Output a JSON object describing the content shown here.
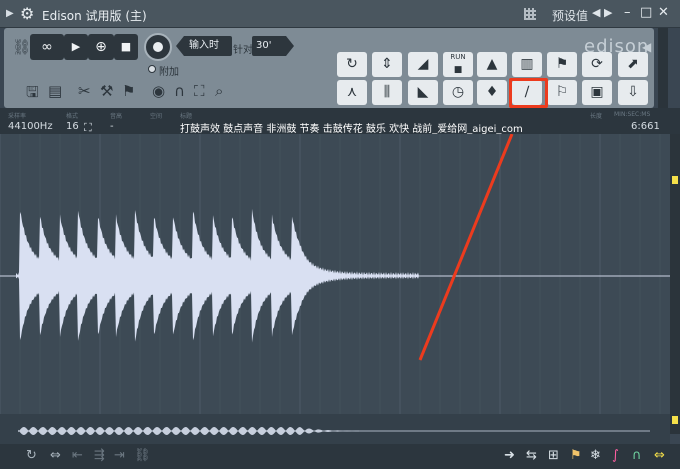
{
  "window": {
    "title": "Edison 试用版 (主)",
    "preset_label": "预设值"
  },
  "toolbar": {
    "input_label": "输入时",
    "for_label": "针对",
    "duration_value": "30'",
    "attach_label": "附加",
    "brand": "edison"
  },
  "tools_row1": [
    {
      "name": "refresh-icon",
      "glyph": "↻"
    },
    {
      "name": "center-split-icon",
      "glyph": "⇕"
    },
    {
      "name": "ramp-icon",
      "glyph": "◢"
    },
    {
      "name": "run-icon",
      "glyph": "■",
      "sub": "RUN"
    },
    {
      "name": "rocket-icon",
      "glyph": "▲"
    },
    {
      "name": "spectrum-icon",
      "glyph": "▥"
    },
    {
      "name": "marker-add-icon",
      "glyph": "⚑"
    },
    {
      "name": "loop-icon",
      "glyph": "⟳"
    },
    {
      "name": "cursor-select-icon",
      "glyph": "⬈"
    }
  ],
  "tools_row2": [
    {
      "name": "antenna-icon",
      "glyph": "⋏"
    },
    {
      "name": "beat-slice-icon",
      "glyph": "⫼"
    },
    {
      "name": "fade-icon",
      "glyph": "◣"
    },
    {
      "name": "clock-icon",
      "glyph": "◷"
    },
    {
      "name": "drop-icon",
      "glyph": "♦"
    },
    {
      "name": "brush-icon",
      "glyph": "∕"
    },
    {
      "name": "marker-move-icon",
      "glyph": "⚐"
    },
    {
      "name": "save-icon",
      "glyph": "▣"
    },
    {
      "name": "insert-icon",
      "glyph": "⇩"
    }
  ],
  "info": {
    "sample_rate": "44100Hz",
    "bits": "16",
    "description": "打鼓声效 鼓点声音 非洲鼓 节奏 击鼓传花 鼓乐 欢快 战前_爱给网_aigei_com",
    "length": "6:661"
  },
  "colors": {
    "highlight": "#ec3b1e",
    "waveform": "#d9e0f2",
    "background": "#3d4a55"
  }
}
